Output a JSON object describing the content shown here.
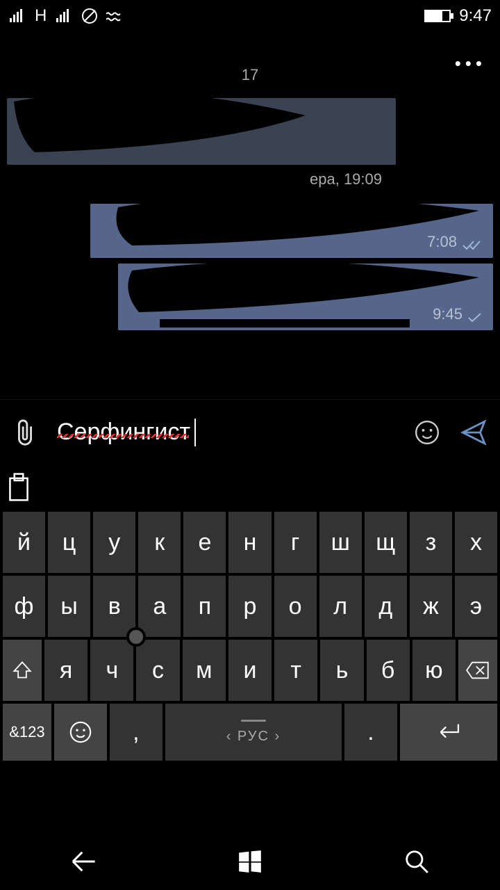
{
  "status": {
    "indicator": "H",
    "time": "9:47"
  },
  "chat": {
    "center_time": "17",
    "bubble_in_meta": "ера, 19:09",
    "bubble_out1_meta": "7:08",
    "bubble_out2_meta": "9:45"
  },
  "input": {
    "text": "Серфингист"
  },
  "keyboard": {
    "row1": [
      "й",
      "ц",
      "у",
      "к",
      "е",
      "н",
      "г",
      "ш",
      "щ",
      "з",
      "х"
    ],
    "row2": [
      "ф",
      "ы",
      "в",
      "а",
      "п",
      "р",
      "о",
      "л",
      "д",
      "ж",
      "э"
    ],
    "row3": [
      "я",
      "ч",
      "с",
      "м",
      "и",
      "т",
      "ь",
      "б",
      "ю"
    ],
    "sym": "&123",
    "comma": ",",
    "lang": "РУС",
    "period": "."
  }
}
